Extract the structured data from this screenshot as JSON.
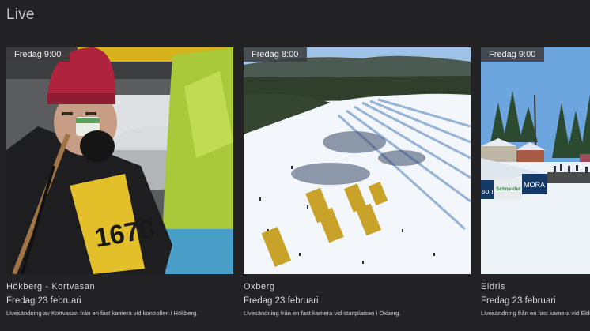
{
  "section": {
    "title": "Live"
  },
  "cards": [
    {
      "time": "Fredag 9:00",
      "title": "Hökberg - Kortvasan",
      "date": "Fredag 23 februari",
      "description": "Livesändning av Kortvasan från en fast kamera vid kontrollen i Hökberg."
    },
    {
      "time": "Fredag 8:00",
      "title": "Oxberg",
      "date": "Fredag 23 februari",
      "description": "Livesändning från en fast kamera vid startplatsen i Oxberg."
    },
    {
      "time": "Fredag 9:00",
      "title": "Eldris",
      "date": "Fredag 23 februari",
      "description": "Livesändning från en fast kamera vid Eldris s"
    }
  ],
  "image_text": {
    "bib_number": "1678",
    "banner_left": "son",
    "banner_middle": "Schneider Electric",
    "banner_right": "MORA"
  },
  "colors": {
    "background": "#232325",
    "badge": "#3c3c3e",
    "text": "#d8d8d8"
  }
}
